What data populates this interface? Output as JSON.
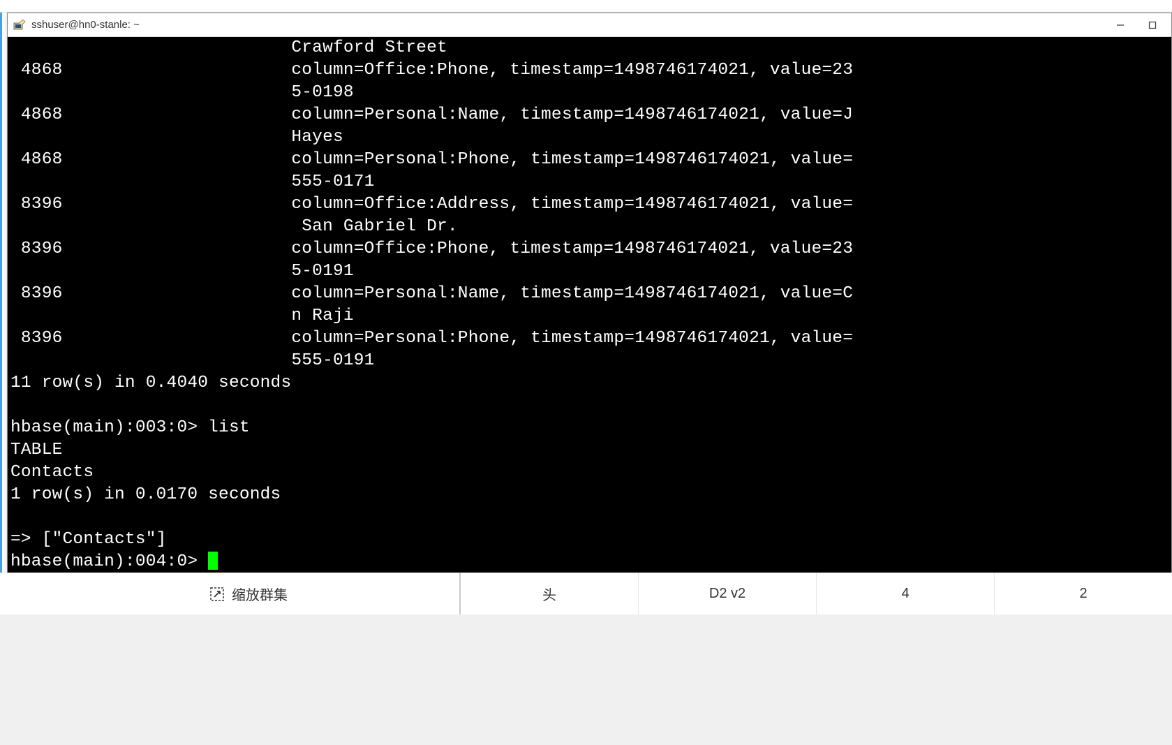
{
  "window": {
    "title": "sshuser@hn0-stanle: ~"
  },
  "terminal": {
    "lines": [
      "                           Crawford Street",
      " 4868                      column=Office:Phone, timestamp=1498746174021, value=23",
      "                           5-0198",
      " 4868                      column=Personal:Name, timestamp=1498746174021, value=J",
      "                           Hayes",
      " 4868                      column=Personal:Phone, timestamp=1498746174021, value=",
      "                           555-0171",
      " 8396                      column=Office:Address, timestamp=1498746174021, value=",
      "                            San Gabriel Dr.",
      " 8396                      column=Office:Phone, timestamp=1498746174021, value=23",
      "                           5-0191",
      " 8396                      column=Personal:Name, timestamp=1498746174021, value=C",
      "                           n Raji",
      " 8396                      column=Personal:Phone, timestamp=1498746174021, value=",
      "                           555-0191",
      "11 row(s) in 0.4040 seconds",
      "",
      "hbase(main):003:0> list",
      "TABLE",
      "Contacts",
      "1 row(s) in 0.0170 seconds",
      "",
      "=> [\"Contacts\"]"
    ],
    "prompt": "hbase(main):004:0> "
  },
  "bottom": {
    "scale_label": "缩放群集",
    "table_headers": [
      "头",
      "D2 v2",
      "4",
      "2"
    ]
  }
}
